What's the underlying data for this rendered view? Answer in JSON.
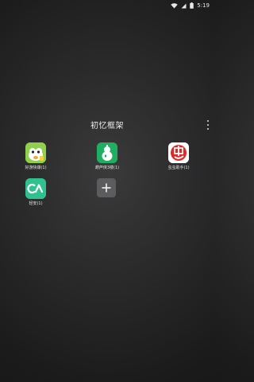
{
  "status_bar": {
    "time": "5:19"
  },
  "folder": {
    "title": "初忆框架"
  },
  "apps": [
    {
      "label": "好游快爆(1)",
      "icon": "haoyou-kuaibao-icon"
    },
    {
      "label": "葫芦侠3楼(1)",
      "icon": "huluxia-icon"
    },
    {
      "label": "虫虫助手(1)",
      "icon": "chongchong-icon"
    },
    {
      "label": "轻安(1)",
      "icon": "qingan-icon"
    }
  ],
  "colors": {
    "haoyou": "#8fd14a",
    "hulu": "#1fae62",
    "chongchong": "#e02828",
    "qingan": "#2fc28f",
    "add_tile": "#5c5c5e"
  }
}
